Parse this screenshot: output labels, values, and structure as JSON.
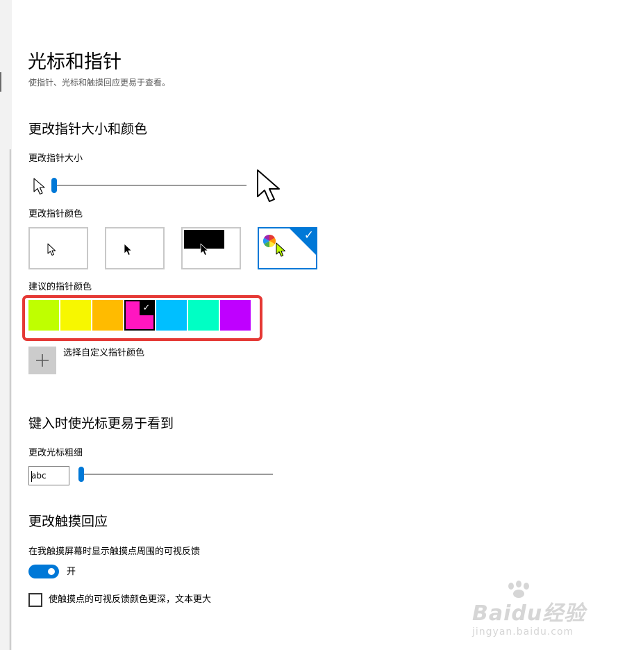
{
  "page": {
    "title": "光标和指针",
    "description": "使指针、光标和触摸回应更易于查看。"
  },
  "pointer_section": {
    "title": "更改指针大小和颜色",
    "size_label": "更改指针大小",
    "size_level": 1,
    "color_label": "更改指针颜色",
    "color_options": [
      "white-pointer",
      "black-pointer",
      "inverted-pointer",
      "custom-color-pointer"
    ],
    "selected_color_option": "custom-color-pointer",
    "suggested_label": "建议的指针颜色",
    "suggested_colors": [
      "#bfff00",
      "#f7f700",
      "#ffbb00",
      "#ff16c0",
      "#00bfff",
      "#00ffc4",
      "#bf00ff"
    ],
    "selected_suggested_color": "#ff16c0",
    "custom_color_label": "选择自定义指针颜色",
    "add_icon": "plus-icon"
  },
  "cursor_section": {
    "title": "键入时使光标更易于看到",
    "thickness_label": "更改光标粗细",
    "preview_text": "abc",
    "thickness_level": 1
  },
  "touch_section": {
    "title": "更改触摸回应",
    "feedback_label": "在我触摸屏幕时显示触摸点周围的可视反馈",
    "toggle_state": "开",
    "darker_label": "使触摸点的可视反馈颜色更深，文本更大",
    "darker_checked": false
  },
  "watermark": {
    "logo": "Baidu经验",
    "url": "jingyan.baidu.com"
  },
  "colors": {
    "accent": "#0078d7",
    "highlight_frame": "#e53935"
  }
}
